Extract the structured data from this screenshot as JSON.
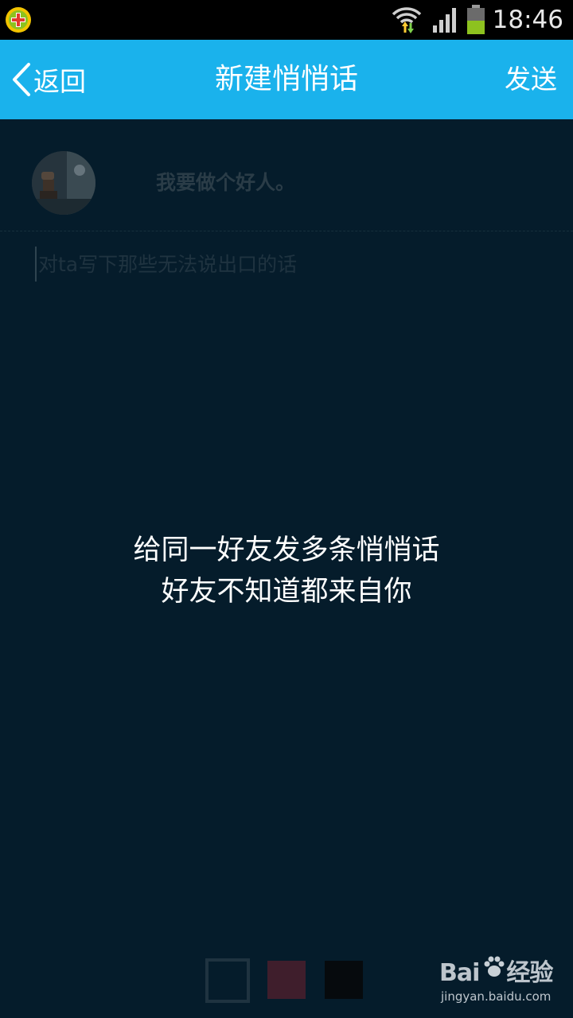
{
  "status_bar": {
    "time": "18:46",
    "app_icon": "add-app-icon",
    "wifi_icon": "wifi-icon",
    "signal_icon": "cell-signal-icon",
    "battery_icon": "battery-icon"
  },
  "title_bar": {
    "back_label": "返回",
    "title": "新建悄悄话",
    "send_label": "发送",
    "background_color": "#1ab2ec"
  },
  "recipient": {
    "name": "我要做个好人。"
  },
  "message": {
    "placeholder": "对ta写下那些无法说出口的话",
    "value": ""
  },
  "hint": {
    "line1": "给同一好友发多条悄悄话",
    "line2": "好友不知道都来自你"
  },
  "swatches": [
    {
      "color": "#051c2b",
      "selected": true
    },
    {
      "color": "#3f1e2c",
      "selected": false
    },
    {
      "color": "#060a0d",
      "selected": false
    }
  ],
  "watermark": {
    "brand_left": "Bai",
    "brand_right": "经验",
    "url": "jingyan.baidu.com"
  }
}
